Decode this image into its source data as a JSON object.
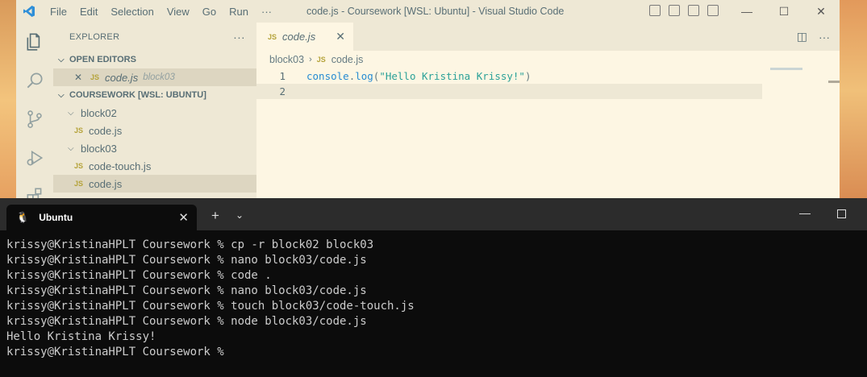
{
  "vscode": {
    "menu": [
      "File",
      "Edit",
      "Selection",
      "View",
      "Go",
      "Run",
      "···"
    ],
    "title": "code.js - Coursework [WSL: Ubuntu] - Visual Studio Code",
    "explorer": {
      "header": "EXPLORER",
      "more": "···",
      "open_editors_label": "OPEN EDITORS",
      "open_editor": {
        "close": "✕",
        "badge": "JS",
        "name": "code.js",
        "desc": "block03"
      },
      "workspace_label": "COURSEWORK [WSL: UBUNTU]",
      "tree": [
        {
          "type": "folder",
          "name": "block02"
        },
        {
          "type": "file",
          "badge": "JS",
          "name": "code.js"
        },
        {
          "type": "folder",
          "name": "block03"
        },
        {
          "type": "file",
          "badge": "JS",
          "name": "code-touch.js"
        },
        {
          "type": "file",
          "badge": "JS",
          "name": "code.js",
          "selected": true
        }
      ]
    },
    "tab": {
      "badge": "JS",
      "name": "code.js",
      "close": "✕"
    },
    "breadcrumb": {
      "folder": "block03",
      "sep": "›",
      "badge": "JS",
      "file": "code.js"
    },
    "code": {
      "line1_no": "1",
      "line1_ident": "console",
      "line1_dot": ".",
      "line1_fn": "log",
      "line1_open": "(",
      "line1_str": "\"Hello Kristina Krissy!\"",
      "line1_close": ")",
      "line2_no": "2"
    }
  },
  "terminal": {
    "tab_title": "Ubuntu",
    "tab_close": "✕",
    "new_tab": "+",
    "dropdown": "⌄",
    "lines": [
      "krissy@KristinaHPLT Coursework % cp -r block02 block03",
      "krissy@KristinaHPLT Coursework % nano block03/code.js",
      "krissy@KristinaHPLT Coursework % code .",
      "krissy@KristinaHPLT Coursework % nano block03/code.js",
      "krissy@KristinaHPLT Coursework % touch block03/code-touch.js",
      "krissy@KristinaHPLT Coursework % node block03/code.js",
      "Hello Kristina Krissy!",
      "krissy@KristinaHPLT Coursework %"
    ]
  },
  "colors": {
    "accent": "#268bd2",
    "string": "#2aa198",
    "js_badge": "#b5a33a",
    "editor_bg": "#fdf6e3",
    "sidebar_bg": "#eee8d5",
    "terminal_bg": "#0c0c0c"
  },
  "icons": [
    "vscode-logo-icon",
    "explorer-icon",
    "search-icon",
    "source-control-icon",
    "run-debug-icon",
    "extensions-icon",
    "split-editor-icon",
    "linux-tux-icon"
  ]
}
